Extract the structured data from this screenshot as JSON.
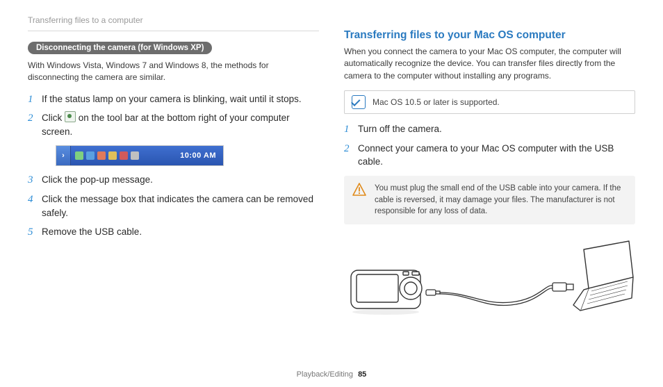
{
  "running_head": "Transferring files to a computer",
  "left": {
    "pill": "Disconnecting the camera (for Windows XP)",
    "intro": "With Windows Vista, Windows 7 and Windows 8, the methods for disconnecting the camera are similar.",
    "steps": {
      "s1": "If the status lamp on your camera is blinking, wait until it stops.",
      "s2a": "Click ",
      "s2b": " on the tool bar at the bottom right of your computer screen.",
      "s3": "Click the pop-up message.",
      "s4": "Click the message box that indicates the camera can be removed safely.",
      "s5": "Remove the USB cable."
    },
    "taskbar": {
      "clock": "10:00 AM"
    }
  },
  "right": {
    "title": "Transferring files to your Mac OS computer",
    "intro": "When you connect the camera to your Mac OS computer, the computer will automatically recognize the device. You can transfer files directly from the camera to the computer without installing any programs.",
    "note": "Mac OS 10.5 or later is supported.",
    "steps": {
      "s1": "Turn off the camera.",
      "s2": "Connect your camera to your Mac OS computer with the USB cable."
    },
    "warn": "You must plug the small end of the USB cable into your camera. If the cable is reversed, it may damage your files. The manufacturer is not responsible for any loss of data."
  },
  "footer": {
    "section": "Playback/Editing",
    "page": "85"
  }
}
